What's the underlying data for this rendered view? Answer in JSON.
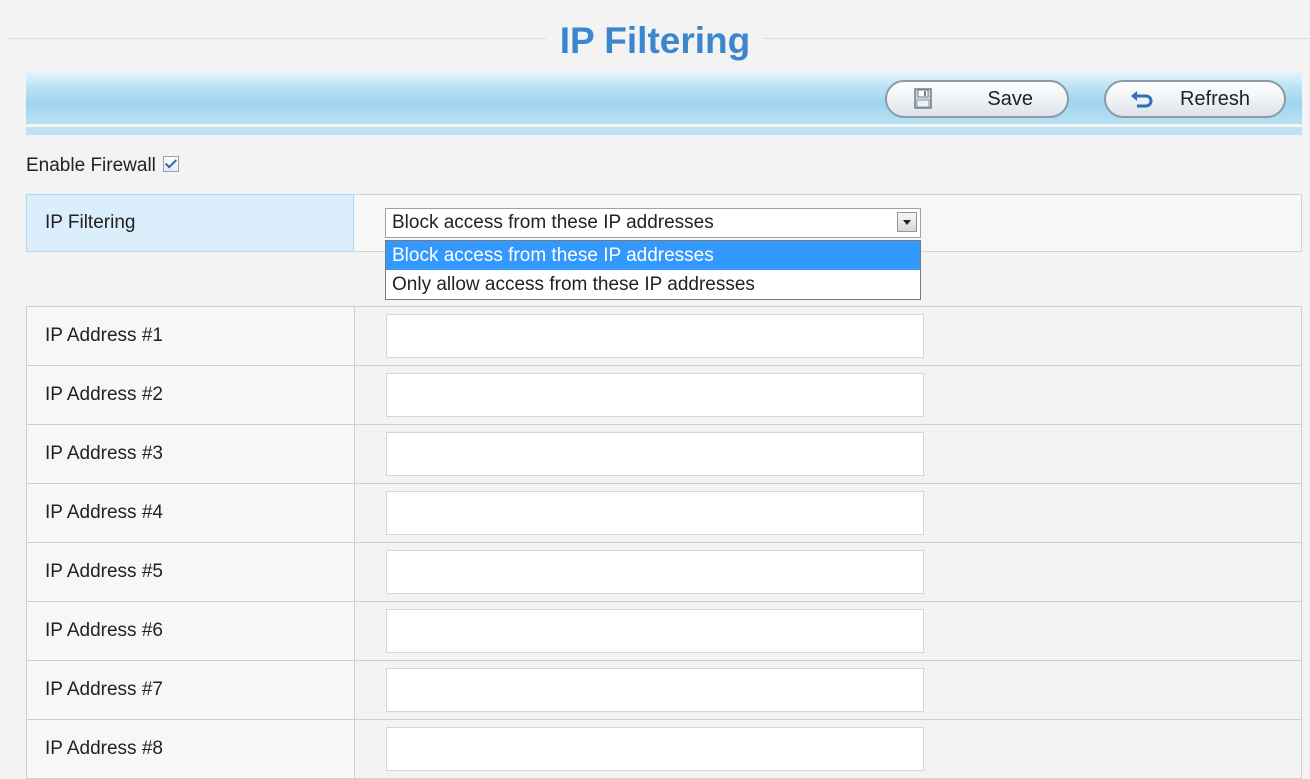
{
  "page": {
    "title": "IP Filtering"
  },
  "toolbar": {
    "save_label": "Save",
    "save_icon": "floppy-disk-icon",
    "refresh_label": "Refresh",
    "refresh_icon": "undo-arrow-icon",
    "accent": "#3b86cf"
  },
  "firewall": {
    "label": "Enable Firewall",
    "checked": true
  },
  "filter": {
    "label": "IP Filtering",
    "selected": "Block access from these IP addresses",
    "options": [
      "Block access from these IP addresses",
      "Only allow access from these IP addresses"
    ],
    "highlighted_option": 0
  },
  "addresses": [
    {
      "label": "IP Address #1",
      "value": ""
    },
    {
      "label": "IP Address #2",
      "value": ""
    },
    {
      "label": "IP Address #3",
      "value": ""
    },
    {
      "label": "IP Address #4",
      "value": ""
    },
    {
      "label": "IP Address #5",
      "value": ""
    },
    {
      "label": "IP Address #6",
      "value": ""
    },
    {
      "label": "IP Address #7",
      "value": ""
    },
    {
      "label": "IP Address #8",
      "value": ""
    }
  ]
}
